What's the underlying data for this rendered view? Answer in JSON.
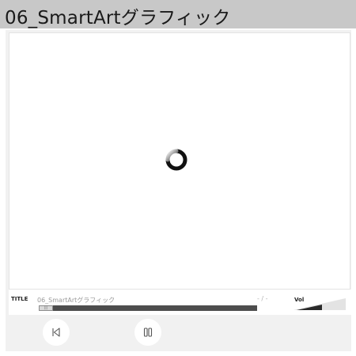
{
  "window": {
    "title": "06_SmartArtグラフィック"
  },
  "player": {
    "status": "loading",
    "info": {
      "title_label": "TITLE",
      "track_name": "06_SmartArtグラフィック",
      "time_readout": "- / -",
      "volume_label": "Vol",
      "progress": 0
    },
    "controls": [
      {
        "name": "previous",
        "icon": "skip-back-icon"
      },
      {
        "name": "pause",
        "icon": "pause-icon"
      }
    ]
  },
  "colors": {
    "title_bar": "#c8c8c8",
    "frame": "#f1f1f1",
    "progress_track": "#4d4d4d",
    "spinner": "#1a1a1a"
  }
}
